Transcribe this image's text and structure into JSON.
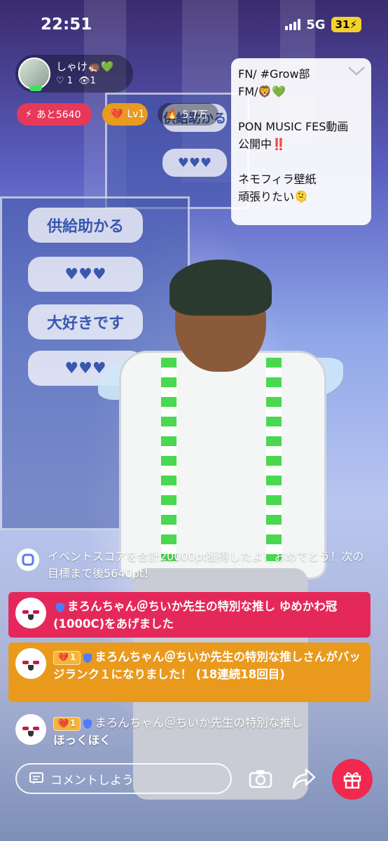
{
  "status_bar": {
    "time": "22:51",
    "network": "5G",
    "battery": "31"
  },
  "streamer": {
    "name": "しゃけ🦔💚",
    "hearts": "1",
    "viewers": "1"
  },
  "pills": {
    "remaining": "あと5640",
    "level": "Lv1",
    "points": "5.7万"
  },
  "notes": {
    "lines": [
      "FN/ #Grow部",
      "FM/🦁💚",
      "",
      "PON MUSIC FES動画",
      "公開中‼️",
      "",
      "ネモフィラ壁紙",
      "頑張りたい🫠"
    ]
  },
  "background": {
    "bubbles": [
      "供給助かる",
      "♥♥♥",
      "大好きです",
      "♥♥♥",
      "供給助かる",
      "♥♥♥"
    ]
  },
  "chat": {
    "system_message": "イベントスコアを合計20000pt獲得したよ！おめでとう！次の目標まで後5640pt！",
    "gift_message": "まろんちゃん＠ちいか先生の特別な推し ゆめかわ冠(1000C)をあげました",
    "badge_level": "1",
    "badge_message": "まろんちゃん＠ちいか先生の特別な推しさんがバッジランク１になりました！ (18連続18回目)",
    "comment_level": "1",
    "comment_user": "まろんちゃん＠ちいか先生の特別な推し",
    "comment_text": "ほっくほく"
  },
  "bottom_bar": {
    "comment_placeholder": "コメントしよう"
  },
  "colors": {
    "gift_bg": "#e5285a",
    "badge_bg": "#e99a1d",
    "accent": "#f2284e"
  }
}
